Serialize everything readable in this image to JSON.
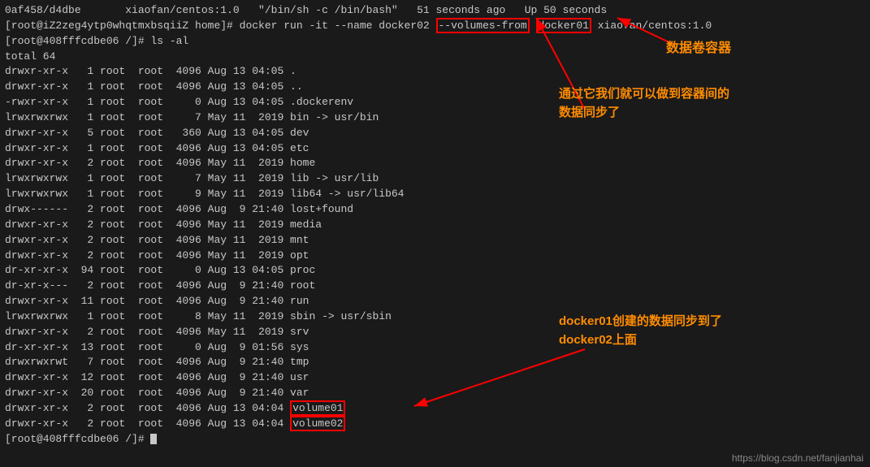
{
  "terminal": {
    "lines": [
      {
        "id": "line1",
        "text": "0af458/d4dbe       xiaofan/centos:1.0   \"/bin/sh -c /bin/bash\"   51 seconds ago   Up 50 seconds"
      },
      {
        "id": "line2",
        "text": "[root@iZ2zeg4ytp0whqtmxbsqiiZ home]# docker run -it --name docker02 "
      },
      {
        "id": "line2b",
        "text_volumes": "--volumes-from",
        "text_docker01": "docker01",
        "text_end": " xiaofan/centos:1.0"
      },
      {
        "id": "line3",
        "text": "[root@408fffcdbe06 /]# ls -al"
      },
      {
        "id": "line4",
        "text": "total 64"
      },
      {
        "id": "line5",
        "text": "drwxr-xr-x   1 root  root  4096 Aug 13 04:05 ."
      },
      {
        "id": "line6",
        "text": "drwxr-xr-x   1 root  root  4096 Aug 13 04:05 .."
      },
      {
        "id": "line7",
        "text": "-rwxr-xr-x   1 root  root     0 Aug 13 04:05 .dockerenv"
      },
      {
        "id": "line8",
        "text": "lrwxrwxrwx   1 root  root     7 May 11  2019 bin -> usr/bin"
      },
      {
        "id": "line9",
        "text": "drwxr-xr-x   5 root  root   360 Aug 13 04:05 dev"
      },
      {
        "id": "line10",
        "text": "drwxr-xr-x   1 root  root  4096 Aug 13 04:05 etc"
      },
      {
        "id": "line11",
        "text": "drwxr-xr-x   2 root  root  4096 May 11  2019 home"
      },
      {
        "id": "line12",
        "text": "lrwxrwxrwx   1 root  root     7 May 11  2019 lib -> usr/lib"
      },
      {
        "id": "line13",
        "text": "lrwxrwxrwx   1 root  root     9 May 11  2019 lib64 -> usr/lib64"
      },
      {
        "id": "line14",
        "text": "drwx------   2 root  root  4096 Aug  9 21:40 lost+found"
      },
      {
        "id": "line15",
        "text": "drwxr-xr-x   2 root  root  4096 May 11  2019 media"
      },
      {
        "id": "line16",
        "text": "drwxr-xr-x   2 root  root  4096 May 11  2019 mnt"
      },
      {
        "id": "line17",
        "text": "drwxr-xr-x   2 root  root  4096 May 11  2019 opt"
      },
      {
        "id": "line18",
        "text": "dr-xr-xr-x  94 root  root     0 Aug 13 04:05 proc"
      },
      {
        "id": "line19",
        "text": "dr-xr-x---   2 root  root  4096 Aug  9 21:40 root"
      },
      {
        "id": "line20",
        "text": "drwxr-xr-x  11 root  root  4096 Aug  9 21:40 run"
      },
      {
        "id": "line21",
        "text": "lrwxrwxrwx   1 root  root     8 May 11  2019 sbin -> usr/sbin"
      },
      {
        "id": "line22",
        "text": "drwxr-xr-x   2 root  root  4096 May 11  2019 srv"
      },
      {
        "id": "line23",
        "text": "dr-xr-xr-x  13 root  root     0 Aug  9 01:56 sys"
      },
      {
        "id": "line24",
        "text": "drwxrwxrwt   7 root  root  4096 Aug  9 21:40 tmp"
      },
      {
        "id": "line25",
        "text": "drwxr-xr-x  12 root  root  4096 Aug  9 21:40 usr"
      },
      {
        "id": "line26",
        "text": "drwxr-xr-x  20 root  root  4096 Aug  9 21:40 var"
      },
      {
        "id": "line27",
        "text": "drwxr-xr-x   2 root  root  4096 Aug 13 04:04 ",
        "highlight": "volume01"
      },
      {
        "id": "line28",
        "text": "drwxr-xr-x   2 root  root  4096 Aug 13 04:04 ",
        "highlight": "volume02"
      },
      {
        "id": "line29",
        "text": "[root@408fffcdbe06 /]# "
      }
    ],
    "annotations": {
      "data_volume_container": "数据卷容器",
      "sync_description": "通过它我们就可以做到容器间的\n数据同步了",
      "sync_description2": "docker01创建的数据同步到了\ndocker02上面"
    },
    "url": "https://blog.csdn.net/fanjianhai"
  }
}
